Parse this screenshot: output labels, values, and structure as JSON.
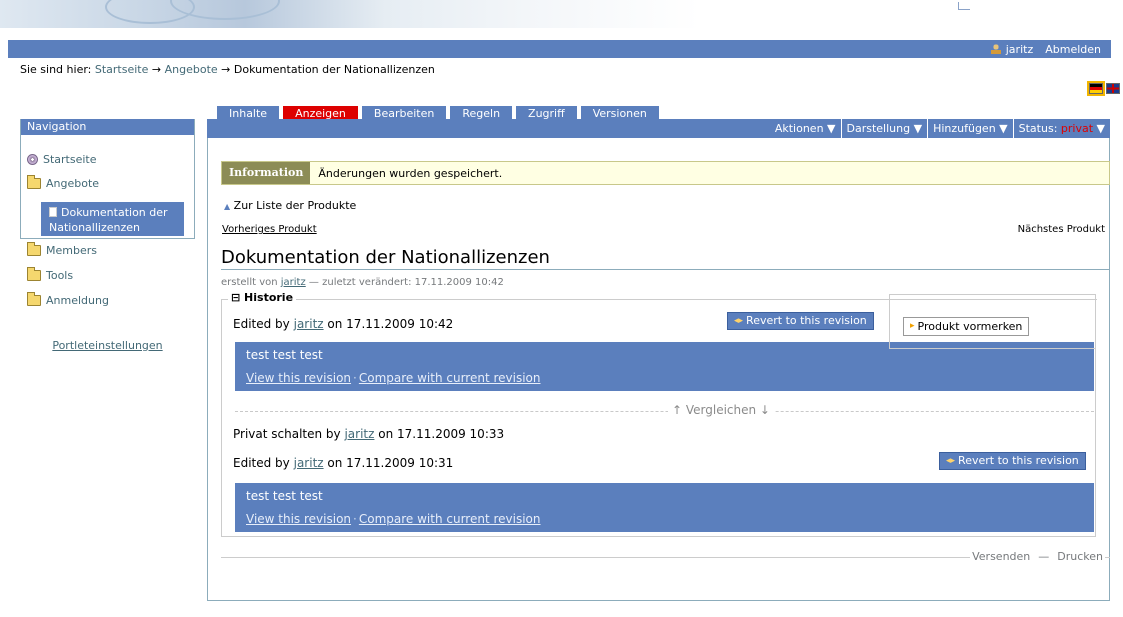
{
  "personal_bar": {
    "user": "jaritz",
    "logout": "Abmelden"
  },
  "breadcrumb": {
    "prefix": "Sie sind hier:",
    "items": [
      "Startseite",
      "Angebote",
      "Dokumentation der Nationallizenzen"
    ],
    "separator": "→"
  },
  "navigation": {
    "title": "Navigation",
    "items": [
      {
        "label": "Startseite",
        "icon": "home-icon"
      },
      {
        "label": "Angebote",
        "icon": "folder-icon"
      },
      {
        "label": "Dokumentation der Nationallizenzen",
        "icon": "document-icon",
        "current": true
      },
      {
        "label": "Members",
        "icon": "folder-icon"
      },
      {
        "label": "Tools",
        "icon": "folder-icon"
      },
      {
        "label": "Anmeldung",
        "icon": "folder-icon"
      }
    ],
    "footer_link": "Portleteinstellungen"
  },
  "tabs": [
    {
      "label": "Inhalte",
      "active": false
    },
    {
      "label": "Anzeigen",
      "active": true
    },
    {
      "label": "Bearbeiten",
      "active": false
    },
    {
      "label": "Regeln",
      "active": false
    },
    {
      "label": "Zugriff",
      "active": false
    },
    {
      "label": "Versionen",
      "active": false
    }
  ],
  "actionbar": {
    "actions": "Aktionen ▼",
    "display": "Darstellung ▼",
    "add": "Hinzufügen ▼",
    "status_label": "Status:",
    "status_value": "privat",
    "status_arrow": "▼"
  },
  "info": {
    "label": "Information",
    "message": "Änderungen wurden gespeichert."
  },
  "nav_links": {
    "back": "Zur Liste der Produkte",
    "previous": "Vorheriges Produkt",
    "next": "Nächstes Produkt"
  },
  "document": {
    "title": "Dokumentation der Nationallizenzen",
    "byline_prefix": "erstellt von",
    "author": "jaritz",
    "byline_modified": "— zuletzt verändert: 17.11.2009 10:42"
  },
  "history": {
    "legend": "⊟ Historie",
    "entries": [
      {
        "action": "Edited by",
        "user": "jaritz",
        "when": "on 17.11.2009 10:42",
        "revert": "Revert to this revision",
        "comment": "test test test",
        "view": "View this revision",
        "compare": "Compare with current revision"
      },
      {
        "action": "Privat schalten by",
        "user": "jaritz",
        "when": "on 17.11.2009 10:33"
      },
      {
        "action": "Edited by",
        "user": "jaritz",
        "when": "on 17.11.2009 10:31",
        "revert": "Revert to this revision",
        "comment": "test test test",
        "view": "View this revision",
        "compare": "Compare with current revision"
      }
    ],
    "compare_label": "↑ Vergleichen ↓"
  },
  "vormerken": {
    "label": "Produkt vormerken"
  },
  "document_actions": {
    "send": "Versenden",
    "print": "Drucken"
  },
  "colors": {
    "accent": "#5b7fbd",
    "active_tab": "#dd0000",
    "info_bg": "#ffffe3"
  }
}
